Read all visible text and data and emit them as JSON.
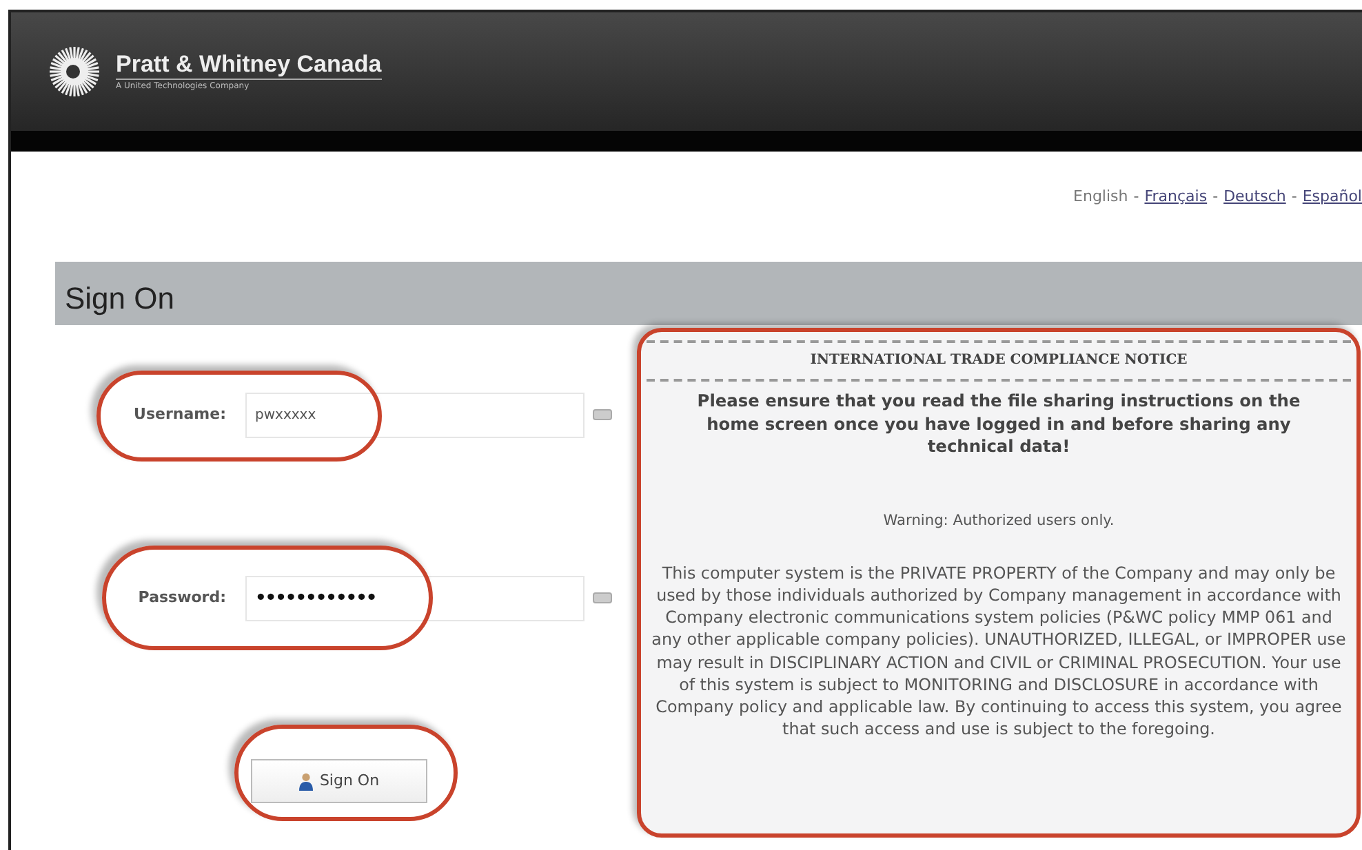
{
  "header": {
    "brand": "Pratt & Whitney Canada",
    "tagline": "A United Technologies Company"
  },
  "languages": [
    {
      "label": "English",
      "selected": true
    },
    {
      "label": "Français",
      "selected": false
    },
    {
      "label": "Deutsch",
      "selected": false
    },
    {
      "label": "Español",
      "selected": false
    }
  ],
  "language_separator": "-",
  "section_title": "Sign On",
  "form": {
    "fields": [
      {
        "label": "Username:",
        "value": "pwxxxxx",
        "kind": "text"
      },
      {
        "label": "Password:",
        "value": "••••••••••••",
        "kind": "password"
      }
    ],
    "button": "Sign On"
  },
  "notice": {
    "title": "INTERNATIONAL TRADE COMPLIANCE NOTICE",
    "emphasis": "Please ensure that you read the file sharing instructions on the home screen once you have logged in and before sharing any technical data!",
    "warning": "Warning: Authorized users only.",
    "body": "This computer system is the PRIVATE PROPERTY of the Company and may only be used by those individuals authorized by Company management in accordance with Company electronic communications system policies (P&WC policy MMP 061 and any other applicable company policies). UNAUTHORIZED, ILLEGAL, or IMPROPER use may result in DISCIPLINARY ACTION and CIVIL or CRIMINAL PROSECUTION. Your use of this system is subject to MONITORING and DISCLOSURE in accordance with Company policy and applicable law. By continuing to access this system, you agree that such access and use is subject to the foregoing."
  }
}
